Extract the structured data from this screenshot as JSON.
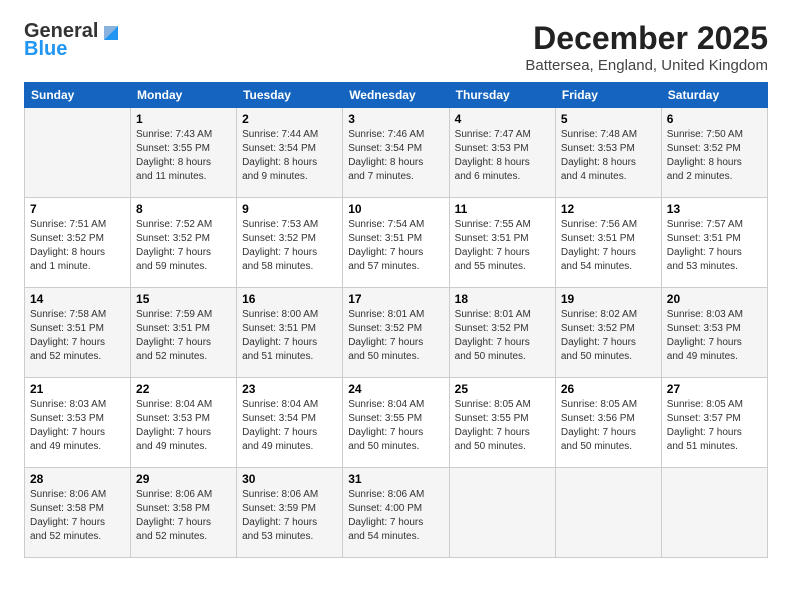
{
  "logo": {
    "general": "General",
    "blue": "Blue"
  },
  "title": "December 2025",
  "location": "Battersea, England, United Kingdom",
  "headers": [
    "Sunday",
    "Monday",
    "Tuesday",
    "Wednesday",
    "Thursday",
    "Friday",
    "Saturday"
  ],
  "weeks": [
    [
      {
        "day": "",
        "info": ""
      },
      {
        "day": "1",
        "info": "Sunrise: 7:43 AM\nSunset: 3:55 PM\nDaylight: 8 hours\nand 11 minutes."
      },
      {
        "day": "2",
        "info": "Sunrise: 7:44 AM\nSunset: 3:54 PM\nDaylight: 8 hours\nand 9 minutes."
      },
      {
        "day": "3",
        "info": "Sunrise: 7:46 AM\nSunset: 3:54 PM\nDaylight: 8 hours\nand 7 minutes."
      },
      {
        "day": "4",
        "info": "Sunrise: 7:47 AM\nSunset: 3:53 PM\nDaylight: 8 hours\nand 6 minutes."
      },
      {
        "day": "5",
        "info": "Sunrise: 7:48 AM\nSunset: 3:53 PM\nDaylight: 8 hours\nand 4 minutes."
      },
      {
        "day": "6",
        "info": "Sunrise: 7:50 AM\nSunset: 3:52 PM\nDaylight: 8 hours\nand 2 minutes."
      }
    ],
    [
      {
        "day": "7",
        "info": "Sunrise: 7:51 AM\nSunset: 3:52 PM\nDaylight: 8 hours\nand 1 minute."
      },
      {
        "day": "8",
        "info": "Sunrise: 7:52 AM\nSunset: 3:52 PM\nDaylight: 7 hours\nand 59 minutes."
      },
      {
        "day": "9",
        "info": "Sunrise: 7:53 AM\nSunset: 3:52 PM\nDaylight: 7 hours\nand 58 minutes."
      },
      {
        "day": "10",
        "info": "Sunrise: 7:54 AM\nSunset: 3:51 PM\nDaylight: 7 hours\nand 57 minutes."
      },
      {
        "day": "11",
        "info": "Sunrise: 7:55 AM\nSunset: 3:51 PM\nDaylight: 7 hours\nand 55 minutes."
      },
      {
        "day": "12",
        "info": "Sunrise: 7:56 AM\nSunset: 3:51 PM\nDaylight: 7 hours\nand 54 minutes."
      },
      {
        "day": "13",
        "info": "Sunrise: 7:57 AM\nSunset: 3:51 PM\nDaylight: 7 hours\nand 53 minutes."
      }
    ],
    [
      {
        "day": "14",
        "info": "Sunrise: 7:58 AM\nSunset: 3:51 PM\nDaylight: 7 hours\nand 52 minutes."
      },
      {
        "day": "15",
        "info": "Sunrise: 7:59 AM\nSunset: 3:51 PM\nDaylight: 7 hours\nand 52 minutes."
      },
      {
        "day": "16",
        "info": "Sunrise: 8:00 AM\nSunset: 3:51 PM\nDaylight: 7 hours\nand 51 minutes."
      },
      {
        "day": "17",
        "info": "Sunrise: 8:01 AM\nSunset: 3:52 PM\nDaylight: 7 hours\nand 50 minutes."
      },
      {
        "day": "18",
        "info": "Sunrise: 8:01 AM\nSunset: 3:52 PM\nDaylight: 7 hours\nand 50 minutes."
      },
      {
        "day": "19",
        "info": "Sunrise: 8:02 AM\nSunset: 3:52 PM\nDaylight: 7 hours\nand 50 minutes."
      },
      {
        "day": "20",
        "info": "Sunrise: 8:03 AM\nSunset: 3:53 PM\nDaylight: 7 hours\nand 49 minutes."
      }
    ],
    [
      {
        "day": "21",
        "info": "Sunrise: 8:03 AM\nSunset: 3:53 PM\nDaylight: 7 hours\nand 49 minutes."
      },
      {
        "day": "22",
        "info": "Sunrise: 8:04 AM\nSunset: 3:53 PM\nDaylight: 7 hours\nand 49 minutes."
      },
      {
        "day": "23",
        "info": "Sunrise: 8:04 AM\nSunset: 3:54 PM\nDaylight: 7 hours\nand 49 minutes."
      },
      {
        "day": "24",
        "info": "Sunrise: 8:04 AM\nSunset: 3:55 PM\nDaylight: 7 hours\nand 50 minutes."
      },
      {
        "day": "25",
        "info": "Sunrise: 8:05 AM\nSunset: 3:55 PM\nDaylight: 7 hours\nand 50 minutes."
      },
      {
        "day": "26",
        "info": "Sunrise: 8:05 AM\nSunset: 3:56 PM\nDaylight: 7 hours\nand 50 minutes."
      },
      {
        "day": "27",
        "info": "Sunrise: 8:05 AM\nSunset: 3:57 PM\nDaylight: 7 hours\nand 51 minutes."
      }
    ],
    [
      {
        "day": "28",
        "info": "Sunrise: 8:06 AM\nSunset: 3:58 PM\nDaylight: 7 hours\nand 52 minutes."
      },
      {
        "day": "29",
        "info": "Sunrise: 8:06 AM\nSunset: 3:58 PM\nDaylight: 7 hours\nand 52 minutes."
      },
      {
        "day": "30",
        "info": "Sunrise: 8:06 AM\nSunset: 3:59 PM\nDaylight: 7 hours\nand 53 minutes."
      },
      {
        "day": "31",
        "info": "Sunrise: 8:06 AM\nSunset: 4:00 PM\nDaylight: 7 hours\nand 54 minutes."
      },
      {
        "day": "",
        "info": ""
      },
      {
        "day": "",
        "info": ""
      },
      {
        "day": "",
        "info": ""
      }
    ]
  ]
}
